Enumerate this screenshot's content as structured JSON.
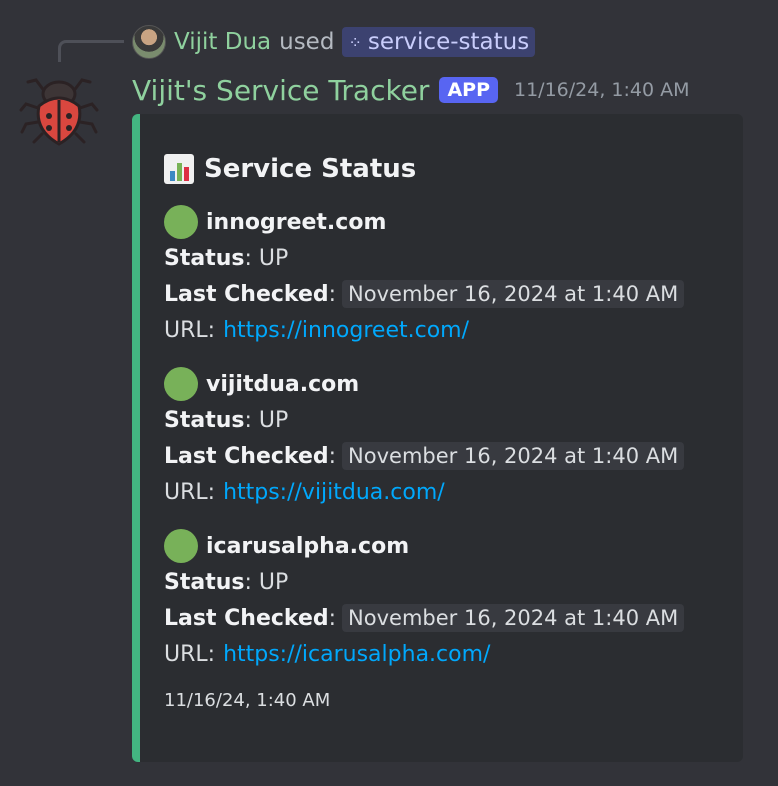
{
  "reply": {
    "username": "Vijit Dua",
    "used_text": "used",
    "command_icon": "slash-command-icon",
    "command": "service-status"
  },
  "message": {
    "bot_name": "Vijit's Service Tracker",
    "app_tag": "APP",
    "timestamp": "11/16/24, 1:40 AM",
    "avatar_icon": "bug-icon"
  },
  "embed": {
    "accent_color": "#43b581",
    "title_icon": "bar-chart-icon",
    "title": "Service Status",
    "status_key": "Status",
    "checked_key": "Last Checked",
    "url_key": "URL:",
    "services": [
      {
        "name": "innogreet.com",
        "status": ": UP",
        "checked": "November 16, 2024 at 1:40 AM",
        "url": "https://innogreet.com/"
      },
      {
        "name": "vijitdua.com",
        "status": ": UP",
        "checked": "November 16, 2024 at 1:40 AM",
        "url": "https://vijitdua.com/"
      },
      {
        "name": "icarusalpha.com",
        "status": ": UP",
        "checked": "November 16, 2024 at 1:40 AM",
        "url": "https://icarusalpha.com/"
      }
    ],
    "footer": "11/16/24, 1:40 AM"
  }
}
